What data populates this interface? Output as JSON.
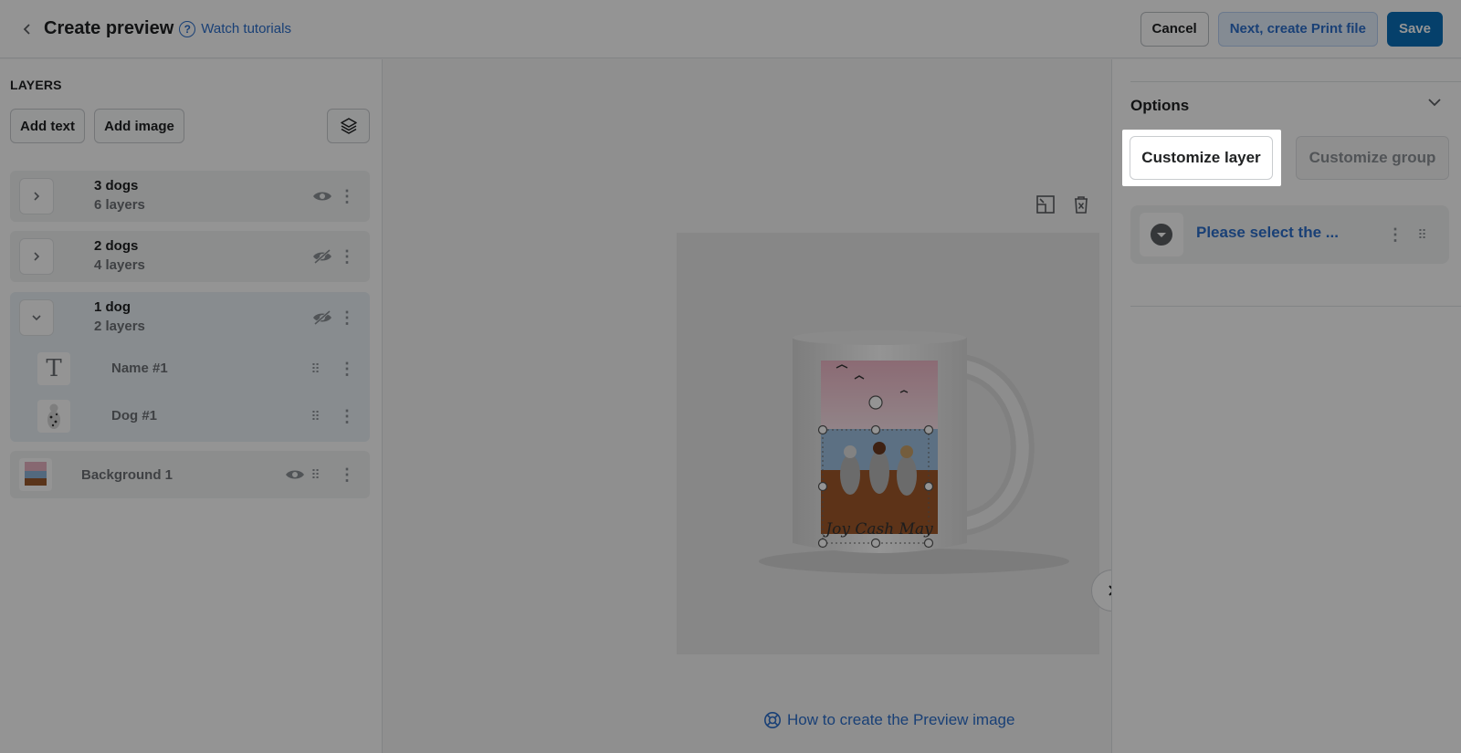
{
  "header": {
    "back_icon": "chevron-left-icon",
    "title": "Create preview",
    "tutorials_label": "Watch tutorials",
    "cancel_label": "Cancel",
    "next_label": "Next, create Print file",
    "save_label": "Save"
  },
  "layers": {
    "title": "LAYERS",
    "add_text_label": "Add text",
    "add_image_label": "Add image",
    "groups": [
      {
        "name": "3 dogs",
        "sub": "6 layers",
        "visible": true,
        "expanded": false
      },
      {
        "name": "2 dogs",
        "sub": "4 layers",
        "visible": false,
        "expanded": false
      },
      {
        "name": "1 dog",
        "sub": "2 layers",
        "visible": false,
        "expanded": true
      }
    ],
    "children": [
      {
        "name": "Name #1",
        "type": "text"
      },
      {
        "name": "Dog #1",
        "type": "image"
      }
    ],
    "background": {
      "name": "Background 1",
      "visible": true
    }
  },
  "canvas": {
    "howto_label": "How to create the Preview image",
    "mug_text": "Joy  Cash  May"
  },
  "options": {
    "title": "Options",
    "customize_layer_label": "Customize layer",
    "customize_group_label": "Customize group",
    "item_label": "Please select the ..."
  },
  "colors": {
    "accent": "#2c6ecb",
    "primary": "#0a6fb8"
  }
}
